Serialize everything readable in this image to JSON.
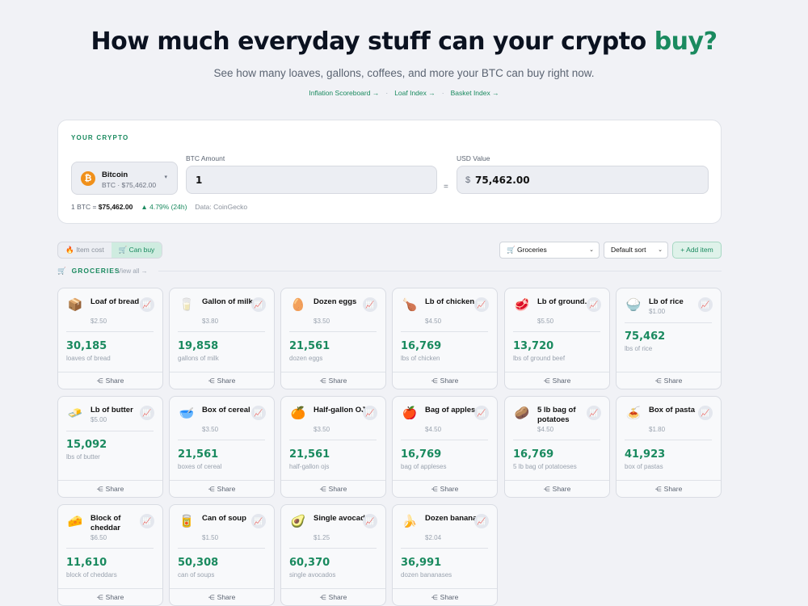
{
  "hero": {
    "title_main": "How much everyday stuff can your crypto",
    "title_accent": "buy?",
    "subtitle": "See how many loaves, gallons, coffees, and more your BTC can buy right now.",
    "links": [
      "Inflation Scoreboard →",
      "Loaf Index →",
      "Basket Index →"
    ],
    "link_separator": "·"
  },
  "converter": {
    "section_label": "YOUR CRYPTO",
    "coin": {
      "name": "Bitcoin",
      "sub": "BTC · $75,462.00",
      "icon": "bitcoin-icon",
      "icon_glyph": "₿",
      "caret": "▾"
    },
    "btc_amount": {
      "label": "BTC Amount",
      "value": "1"
    },
    "equals": "=",
    "usd_value": {
      "label": "USD Value",
      "currency": "$",
      "value": "75,462.00"
    },
    "rate_prefix": "1 BTC = ",
    "rate_value": "$75,462.00",
    "change": "▲ 4.79% (24h)",
    "source": "Data: CoinGecko"
  },
  "toolbar": {
    "mode_item_cost": "🔥 Item cost",
    "mode_can_buy": "🛒 Can buy",
    "category_select": "🛒 Groceries",
    "sort_select": "Default sort",
    "add_item": "+ Add item",
    "select_caret": "⌄"
  },
  "section": {
    "icon": "🛒",
    "title": "GROCERIES",
    "view_all": "View all →"
  },
  "share_icon": "⋲",
  "share_label": "Share",
  "chart_icon": "📈",
  "items": [
    {
      "icon": "📦",
      "name": "Loaf of bread",
      "price": "$2.50",
      "count": "30,185",
      "unit": "loaves of bread",
      "lines": 2
    },
    {
      "icon": "🥛",
      "name": "Gallon of milk",
      "price": "$3.80",
      "count": "19,858",
      "unit": "gallons of milk",
      "lines": 2
    },
    {
      "icon": "🥚",
      "name": "Dozen eggs",
      "price": "$3.50",
      "count": "21,561",
      "unit": "dozen eggs",
      "lines": 2
    },
    {
      "icon": "🍗",
      "name": "Lb of chicken",
      "price": "$4.50",
      "count": "16,769",
      "unit": "lbs of chicken",
      "lines": 2
    },
    {
      "icon": "🥩",
      "name": "Lb of ground...",
      "price": "$5.50",
      "count": "13,720",
      "unit": "lbs of ground beef",
      "lines": 2
    },
    {
      "icon": "🍚",
      "name": "Lb of rice",
      "price": "$1.00",
      "count": "75,462",
      "unit": "lbs of rice",
      "lines": 1
    },
    {
      "icon": "🧈",
      "name": "Lb of butter",
      "price": "$5.00",
      "count": "15,092",
      "unit": "lbs of butter",
      "lines": 1
    },
    {
      "icon": "🥣",
      "name": "Box of cereal",
      "price": "$3.50",
      "count": "21,561",
      "unit": "boxes of cereal",
      "lines": 2
    },
    {
      "icon": "🍊",
      "name": "Half-gallon OJ",
      "price": "$3.50",
      "count": "21,561",
      "unit": "half-gallon ojs",
      "lines": 2
    },
    {
      "icon": "🍎",
      "name": "Bag of apples",
      "price": "$4.50",
      "count": "16,769",
      "unit": "bag of appleses",
      "lines": 2
    },
    {
      "icon": "🥔",
      "name": "5 lb bag of potatoes",
      "price": "$4.50",
      "count": "16,769",
      "unit": "5 lb bag of potatoeses",
      "lines": 2
    },
    {
      "icon": "🍝",
      "name": "Box of pasta",
      "price": "$1.80",
      "count": "41,923",
      "unit": "box of pastas",
      "lines": 2
    },
    {
      "icon": "🧀",
      "name": "Block of cheddar",
      "price": "$6.50",
      "count": "11,610",
      "unit": "block of cheddars",
      "lines": 2
    },
    {
      "icon": "🥫",
      "name": "Can of soup",
      "price": "$1.50",
      "count": "50,308",
      "unit": "can of soups",
      "lines": 2
    },
    {
      "icon": "🥑",
      "name": "Single avocado",
      "price": "$1.25",
      "count": "60,370",
      "unit": "single avocados",
      "lines": 2
    },
    {
      "icon": "🍌",
      "name": "Dozen bananas",
      "price": "$2.04",
      "count": "36,991",
      "unit": "dozen bananases",
      "lines": 2
    }
  ]
}
